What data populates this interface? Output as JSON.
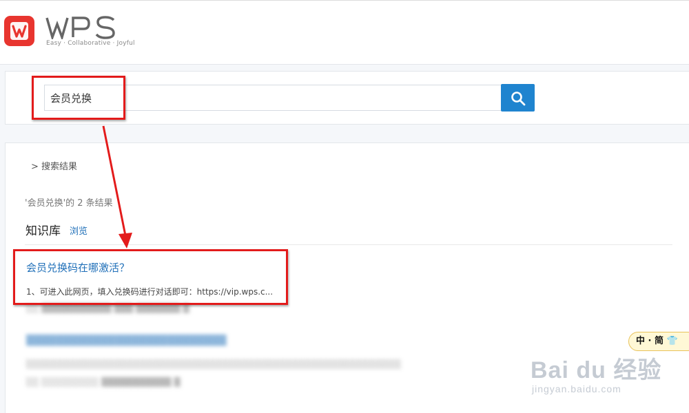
{
  "header": {
    "logo_text": "WPS",
    "tagline": "Easy · Collaborative · Joyful"
  },
  "search": {
    "value": "会员兑换"
  },
  "results": {
    "breadcrumb": "> 搜索结果",
    "count_text": "'会员兑换'的 2 条结果",
    "section_title": "知识库",
    "browse_label": "浏览",
    "items": [
      {
        "title": "会员兑换码在哪激活？",
        "snippet": "1、可进入此网页，填入兑换码进行对话即可：https://vip.wps.c..."
      }
    ]
  },
  "ime": {
    "text": "中 · 简"
  },
  "watermark": {
    "main": "Bai du 经验",
    "sub": "jingyan.baidu.com"
  },
  "colors": {
    "accent": "#1f84cf",
    "link": "#1f6fb8",
    "highlight": "#e31b1b",
    "logo_red": "#e8352f"
  }
}
